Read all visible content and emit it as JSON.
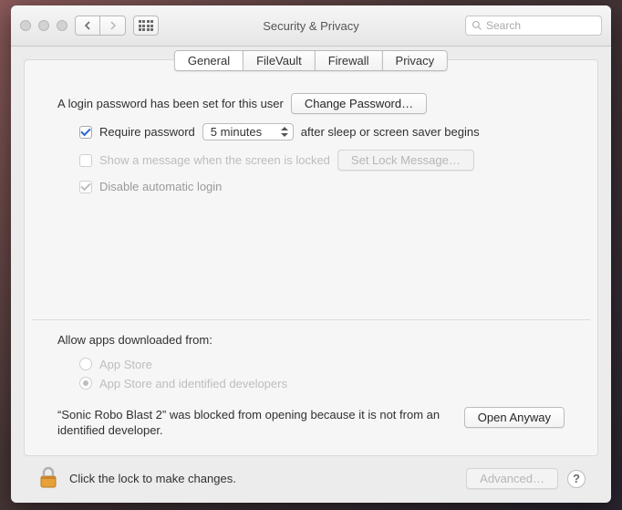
{
  "window": {
    "title": "Security & Privacy",
    "search_placeholder": "Search"
  },
  "tabs": [
    "General",
    "FileVault",
    "Firewall",
    "Privacy"
  ],
  "login": {
    "password_set": "A login password has been set for this user",
    "change_password_btn": "Change Password…",
    "require_password_label": "Require password",
    "require_password_delay": "5 minutes",
    "require_password_suffix": "after sleep or screen saver begins",
    "show_message_label": "Show a message when the screen is locked",
    "set_lock_message_btn": "Set Lock Message…",
    "disable_auto_login": "Disable automatic login"
  },
  "gatekeeper": {
    "heading": "Allow apps downloaded from:",
    "option_appstore": "App Store",
    "option_identified": "App Store and identified developers",
    "blocked_text": "“Sonic Robo Blast 2” was blocked from opening because it is not from an identified developer.",
    "open_anyway_btn": "Open Anyway"
  },
  "footer": {
    "lock_text": "Click the lock to make changes.",
    "advanced_btn": "Advanced…",
    "help": "?"
  }
}
